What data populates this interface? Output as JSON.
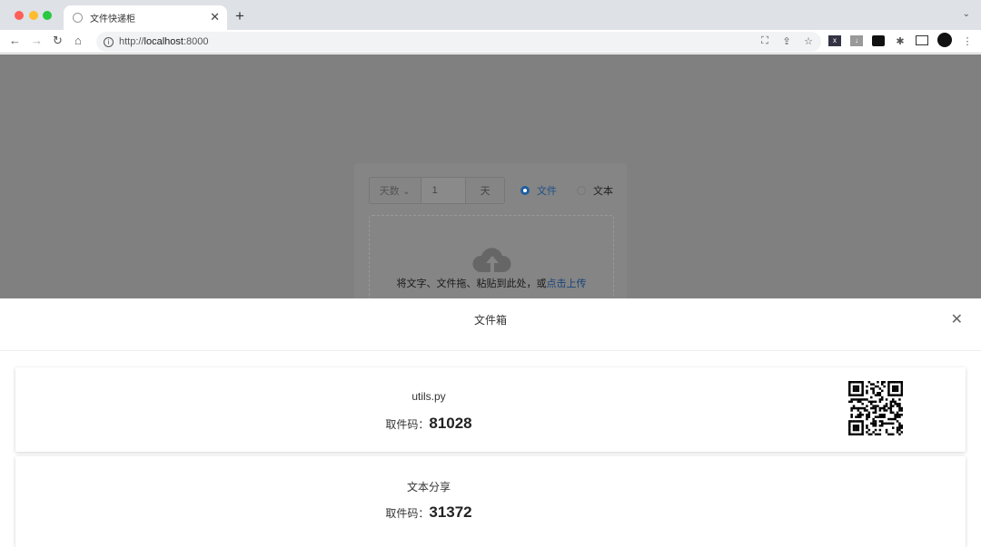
{
  "browser": {
    "tab_title": "文件快递柜",
    "url_prefix": "http://",
    "url_host": "localhost",
    "url_port": ":8000"
  },
  "page": {
    "expire_select": "天数",
    "expire_value": "1",
    "expire_unit": "天",
    "radio_file": "文件",
    "radio_text": "文本",
    "drop_text": "将文字、文件拖、粘贴到此处，或",
    "drop_link": "点击上传"
  },
  "drawer": {
    "title": "文件箱",
    "items": [
      {
        "name": "utils.py",
        "code_label": "取件码：",
        "code": "81028"
      },
      {
        "name": "文本分享",
        "code_label": "取件码：",
        "code": "31372"
      }
    ]
  },
  "colors": {
    "accent": "#409eff"
  }
}
